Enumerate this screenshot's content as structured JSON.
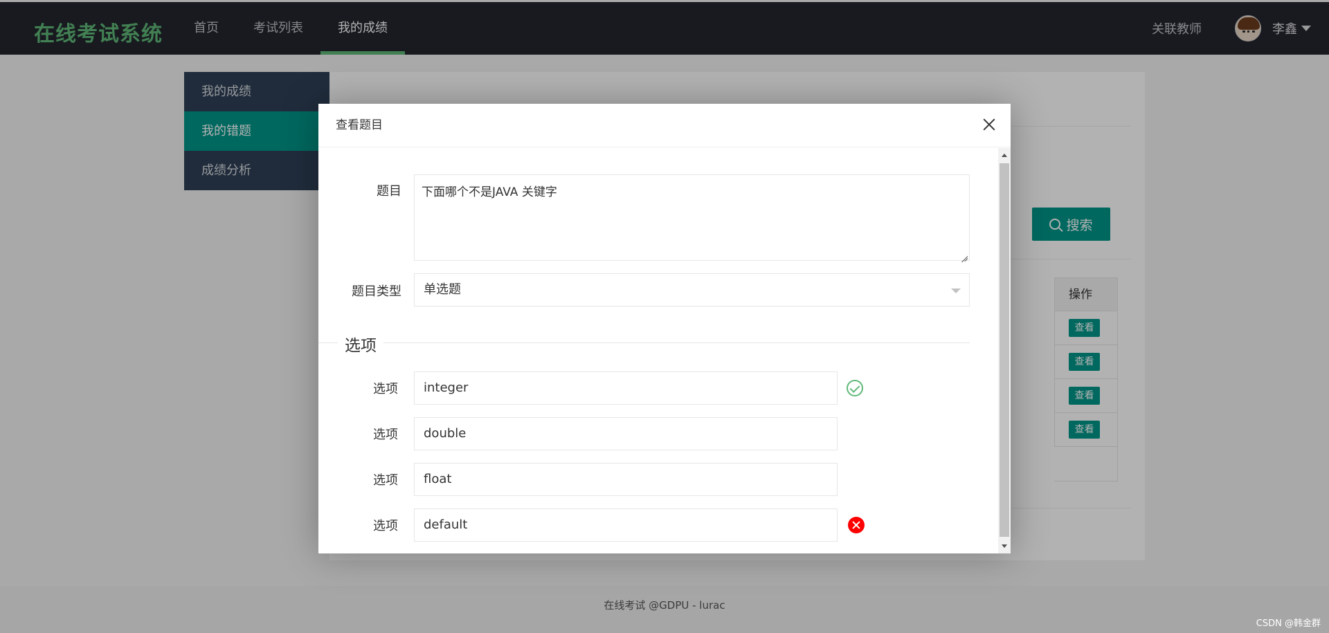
{
  "header": {
    "logo": "在线考试系统",
    "nav": [
      {
        "label": "首页"
      },
      {
        "label": "考试列表"
      },
      {
        "label": "我的成绩"
      }
    ],
    "teacher_link": "关联教师",
    "username": "李鑫"
  },
  "sidebar": {
    "items": [
      {
        "label": "我的成绩"
      },
      {
        "label": "我的错题"
      },
      {
        "label": "成绩分析"
      }
    ]
  },
  "page": {
    "search_label": "搜索",
    "table_header_op": "操作",
    "view_label": "查看"
  },
  "footer": {
    "text": "在线考试 @GDPU - lurac"
  },
  "watermark": "CSDN @韩金群",
  "modal": {
    "title": "查看题目",
    "question_label": "题目",
    "question_text": "下面哪个不是JAVA 关键字",
    "type_label": "题目类型",
    "type_value": "单选题",
    "options_legend": "选项",
    "option_label": "选项",
    "options": [
      {
        "value": "integer",
        "mark": "correct"
      },
      {
        "value": "double",
        "mark": ""
      },
      {
        "value": "float",
        "mark": ""
      },
      {
        "value": "default",
        "mark": "wrong"
      }
    ]
  },
  "colors": {
    "header_bg": "#23262e",
    "logo": "#5fb878",
    "accent": "#009688",
    "sidebar_bg": "#2f4056",
    "correct": "#5fb878",
    "wrong": "#ff0000"
  }
}
